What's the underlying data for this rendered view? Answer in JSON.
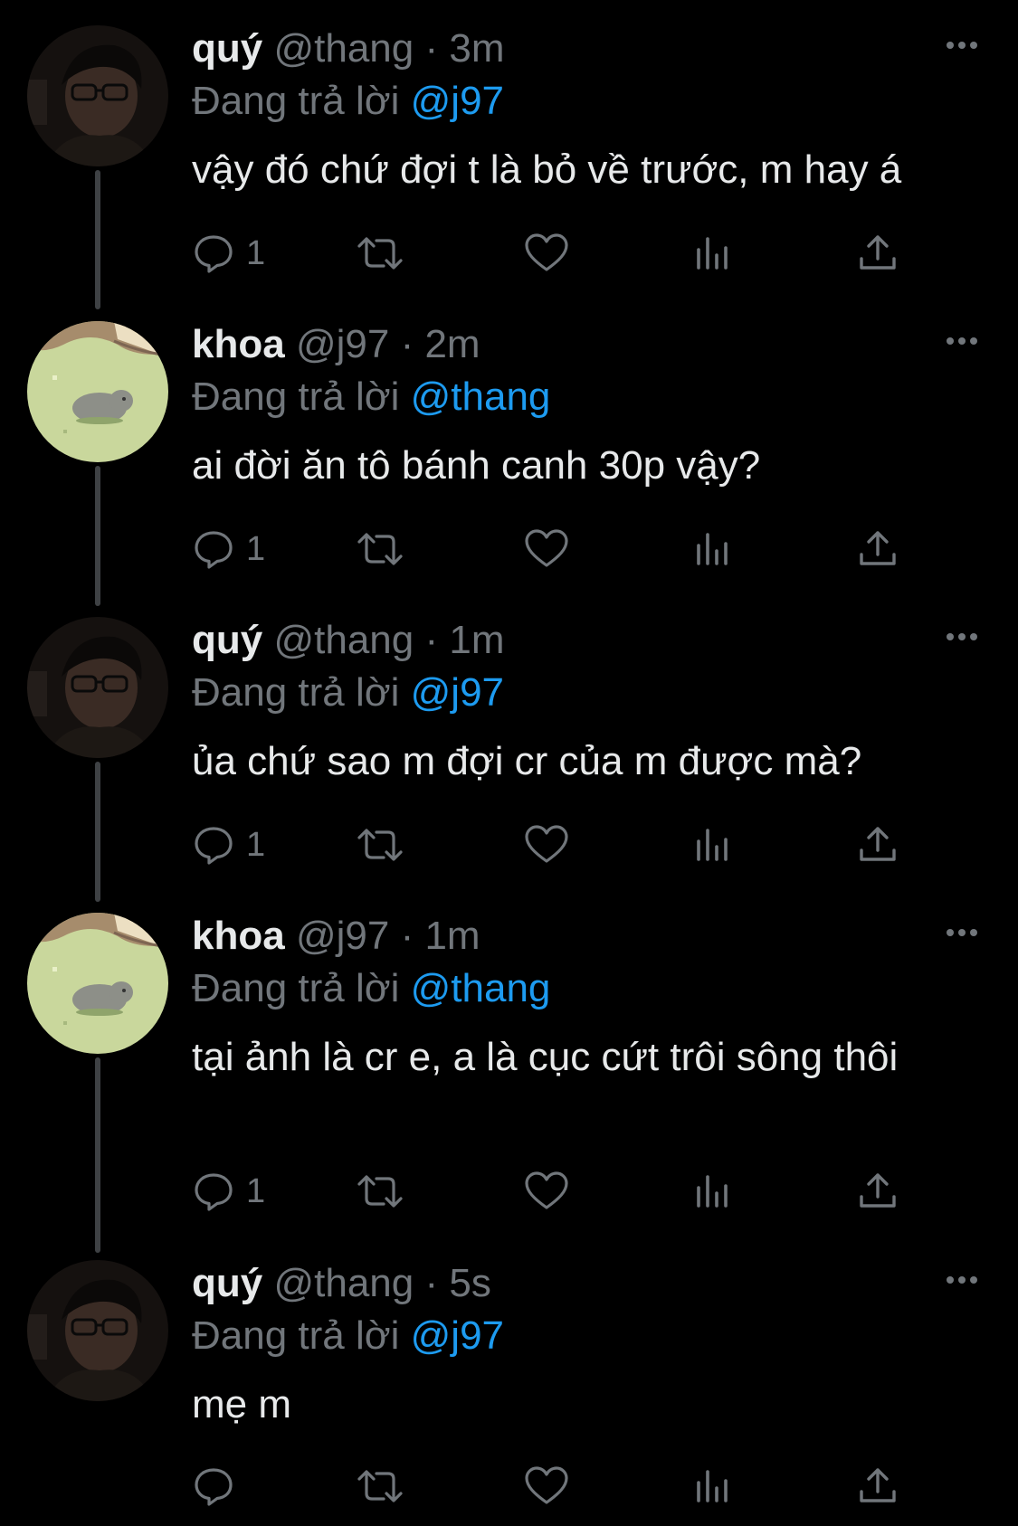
{
  "thread": {
    "tweets": [
      {
        "author": "quý",
        "handle": "@thang",
        "separator": "·",
        "time": "3m",
        "replying_prefix": "Đang trả lời",
        "replying_to": "@j97",
        "text": "vậy đó chứ đợi t là bỏ về trước, m hay á",
        "reply_count": "1",
        "avatar": "dark-photo-person-glasses"
      },
      {
        "author": "khoa",
        "handle": "@j97",
        "separator": "·",
        "time": "2m",
        "replying_prefix": "Đang trả lời",
        "replying_to": "@thang",
        "text": "ai đời ăn tô bánh canh 30p vậy?",
        "reply_count": "1",
        "avatar": "pixel-art-cat-on-grass"
      },
      {
        "author": "quý",
        "handle": "@thang",
        "separator": "·",
        "time": "1m",
        "replying_prefix": "Đang trả lời",
        "replying_to": "@j97",
        "text": "ủa chứ sao m đợi cr của m được mà?",
        "reply_count": "1",
        "avatar": "dark-photo-person-glasses"
      },
      {
        "author": "khoa",
        "handle": "@j97",
        "separator": "·",
        "time": "1m",
        "replying_prefix": "Đang trả lời",
        "replying_to": "@thang",
        "text": "tại ảnh là cr e, a là cục cứt trôi sông thôi",
        "reply_count": "1",
        "avatar": "pixel-art-cat-on-grass"
      },
      {
        "author": "quý",
        "handle": "@thang",
        "separator": "·",
        "time": "5s",
        "replying_prefix": "Đang trả lời",
        "replying_to": "@j97",
        "text": "mẹ m",
        "reply_count": "",
        "avatar": "dark-photo-person-glasses"
      }
    ]
  },
  "icons": {
    "more": "more-horizontal-icon",
    "reply": "reply-bubble-icon",
    "retweet": "retweet-icon",
    "like": "heart-icon",
    "views": "views-bar-chart-icon",
    "share": "share-upload-icon"
  },
  "colors": {
    "background": "#000000",
    "text_primary": "#e7e9ea",
    "text_secondary": "#71767b",
    "mention": "#1d9bf0",
    "thread_line": "#3e4144"
  }
}
